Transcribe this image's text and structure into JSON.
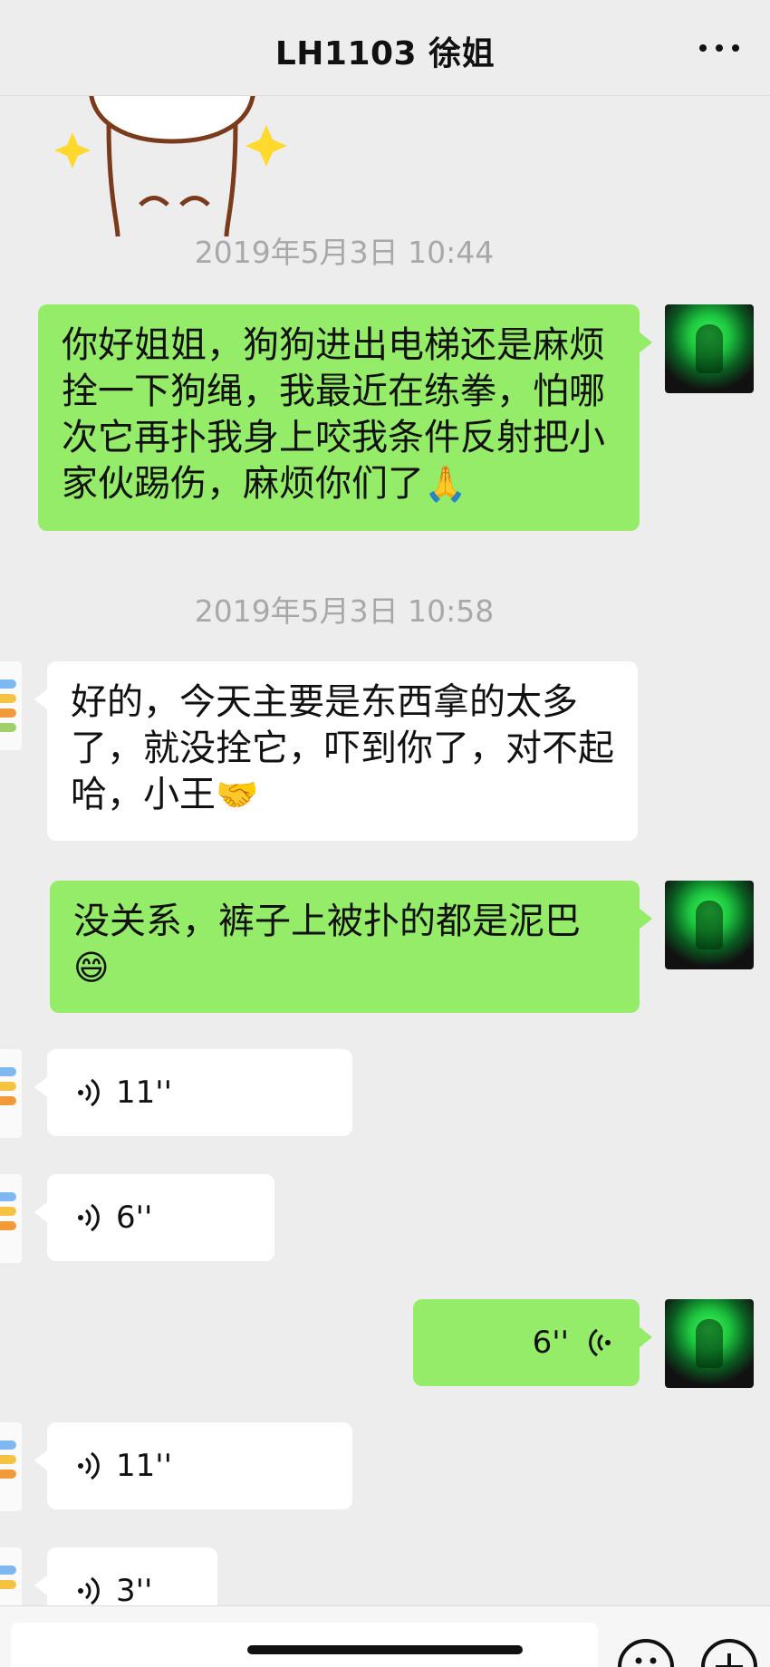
{
  "header": {
    "title": "LH1103 徐姐",
    "more_icon": "more-dots-icon"
  },
  "messages": {
    "time1": "2019年5月3日 10:44",
    "msg1": "你好姐姐，狗狗进出电梯还是麻烦拴一下狗绳，我最近在练拳，怕哪次它再扑我身上咬我条件反射把小家伙踢伤，麻烦你们了",
    "msg1_emoji": "🙏",
    "time2": "2019年5月3日 10:58",
    "msg2": "好的，今天主要是东西拿的太多了，就没拴它，吓到你了，对不起哈，小王",
    "msg2_emoji": "🤝",
    "msg3": "没关系，裤子上被扑的都是泥巴",
    "msg3_emoji": "😄",
    "voice1": "11''",
    "voice2": "6''",
    "voice3": "6''",
    "voice4": "11''",
    "voice5": "3''"
  },
  "colors": {
    "my_bubble": "#95ec69",
    "their_bubble": "#ffffff",
    "background": "#ededed"
  },
  "icons": {
    "voice": "voice-wave-icon",
    "emoji": "emoji-face-icon",
    "add": "plus-circle-icon"
  }
}
